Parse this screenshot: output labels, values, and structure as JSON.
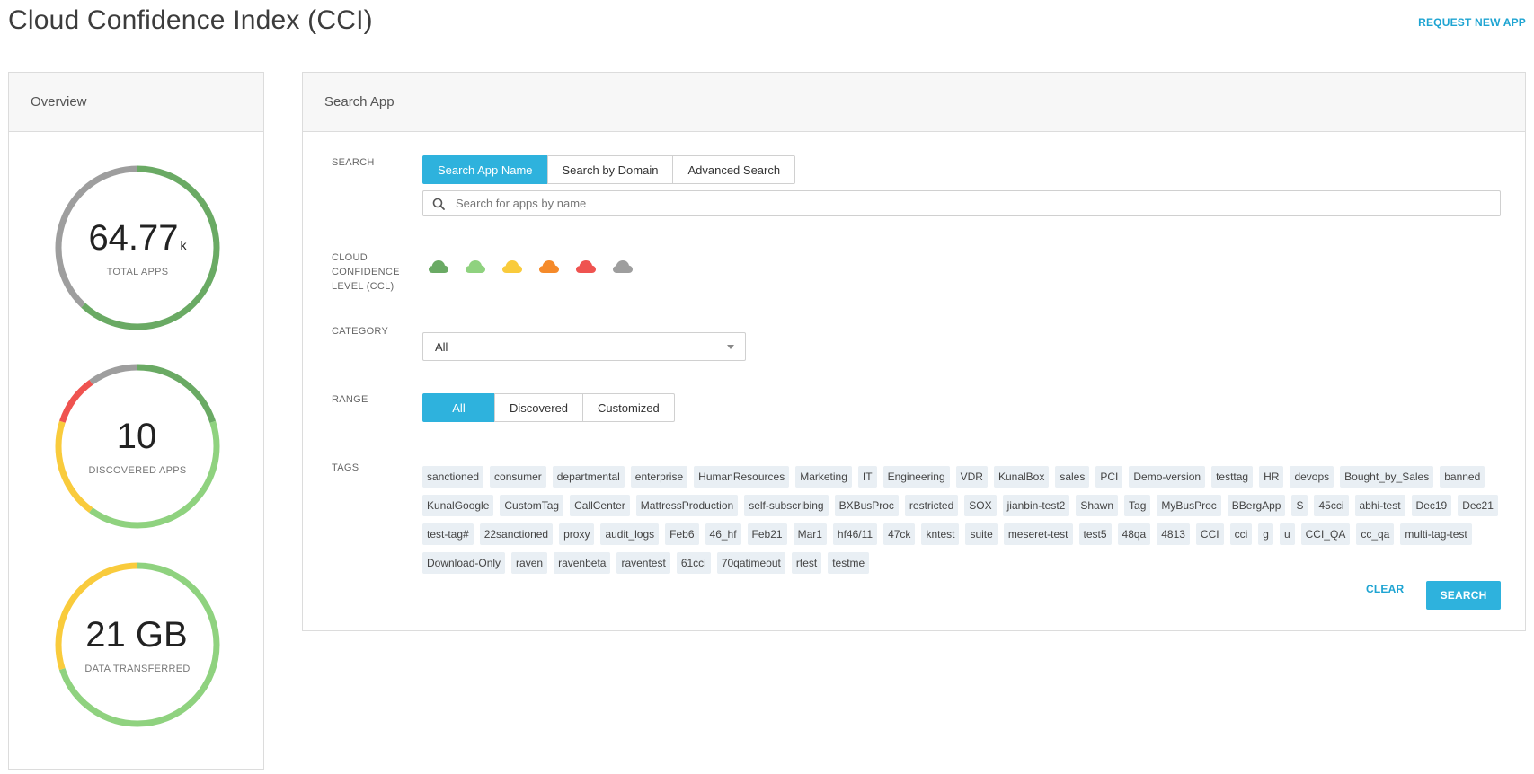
{
  "page": {
    "title": "Cloud Confidence Index (CCI)",
    "request_link": "REQUEST NEW APP"
  },
  "overview": {
    "header": "Overview",
    "stats": [
      {
        "value": "64.77",
        "suffix": "k",
        "label": "TOTAL APPS",
        "segments": [
          {
            "color": "#6aaa64",
            "fraction": 0.62
          },
          {
            "color": "#9e9e9e",
            "fraction": 0.38
          }
        ]
      },
      {
        "value": "10",
        "suffix": "",
        "label": "DISCOVERED APPS",
        "segments": [
          {
            "color": "#6aaa64",
            "fraction": 0.2
          },
          {
            "color": "#8fd27f",
            "fraction": 0.4
          },
          {
            "color": "#f9cb3c",
            "fraction": 0.2
          },
          {
            "color": "#ef5350",
            "fraction": 0.1
          },
          {
            "color": "#9e9e9e",
            "fraction": 0.1
          }
        ]
      },
      {
        "value": "21 GB",
        "suffix": "",
        "label": "DATA TRANSFERRED",
        "segments": [
          {
            "color": "#8fd27f",
            "fraction": 0.7
          },
          {
            "color": "#f9cb3c",
            "fraction": 0.3
          }
        ]
      }
    ]
  },
  "search_panel": {
    "header": "Search App",
    "search_label": "SEARCH",
    "search_tabs": [
      "Search App Name",
      "Search by Domain",
      "Advanced Search"
    ],
    "search_placeholder": "Search for apps by name",
    "ccl_label": "CLOUD CONFIDENCE LEVEL (CCL)",
    "ccl_levels": [
      {
        "icon": "cloud-icon",
        "color": "#6aaa64"
      },
      {
        "icon": "cloud-icon",
        "color": "#8fd27f"
      },
      {
        "icon": "cloud-icon",
        "color": "#f9cb3c"
      },
      {
        "icon": "cloud-icon",
        "color": "#f58a2a"
      },
      {
        "icon": "cloud-icon",
        "color": "#ef5350"
      },
      {
        "icon": "cloud-icon",
        "color": "#9e9e9e"
      }
    ],
    "category_label": "CATEGORY",
    "category_value": "All",
    "range_label": "RANGE",
    "range_options": [
      "All",
      "Discovered",
      "Customized"
    ],
    "tags_label": "TAGS",
    "tags": [
      "sanctioned",
      "consumer",
      "departmental",
      "enterprise",
      "HumanResources",
      "Marketing",
      "IT",
      "Engineering",
      "VDR",
      "KunalBox",
      "sales",
      "PCI",
      "Demo-version",
      "testtag",
      "HR",
      "devops",
      "Bought_by_Sales",
      "banned",
      "KunalGoogle",
      "CustomTag",
      "CallCenter",
      "MattressProduction",
      "self-subscribing",
      "BXBusProc",
      "restricted",
      "SOX",
      "jianbin-test2",
      "Shawn",
      "Tag",
      "MyBusProc",
      "BBergApp",
      "S",
      "45cci",
      "abhi-test",
      "Dec19",
      "Dec21",
      "test-tag#",
      "22sanctioned",
      "proxy",
      "audit_logs",
      "Feb6",
      "46_hf",
      "Feb21",
      "Mar1",
      "hf46/11",
      "47ck",
      "kntest",
      "suite",
      "meseret-test",
      "test5",
      "48qa",
      "4813",
      "CCI",
      "cci",
      "g",
      "u",
      "CCI_QA",
      "cc_qa",
      "multi-tag-test",
      "Download-Only",
      "raven",
      "ravenbeta",
      "raventest",
      "61cci",
      "70qatimeout",
      "rtest",
      "testme"
    ],
    "clear_label": "CLEAR",
    "search_button": "SEARCH"
  },
  "accent": "#2eb2dd"
}
